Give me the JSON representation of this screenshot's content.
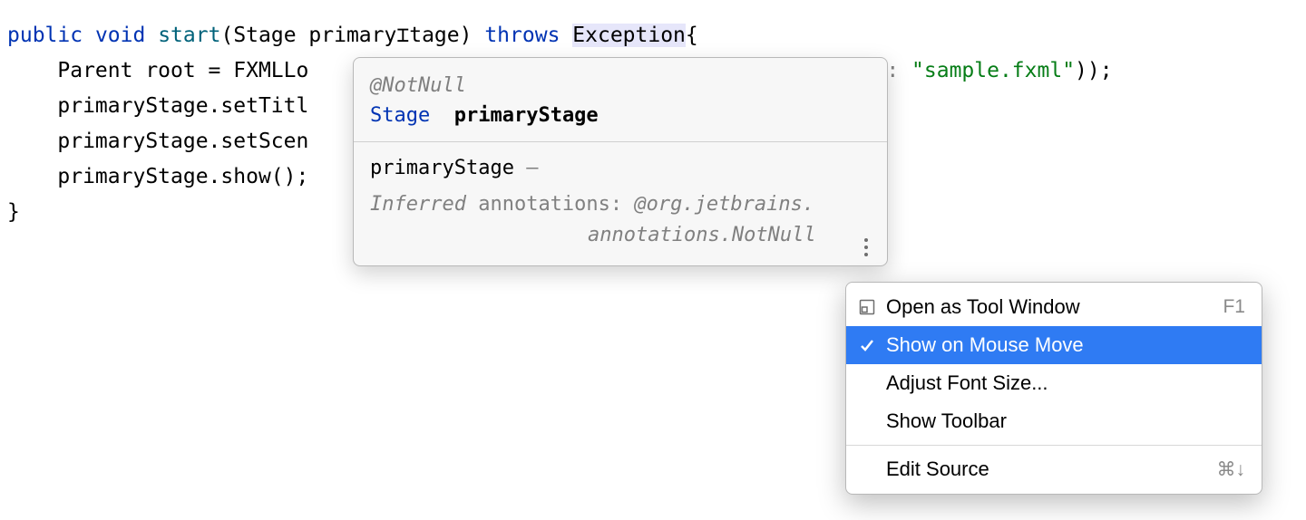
{
  "code": {
    "line1": {
      "public": "public",
      "void": "void",
      "start": "start",
      "open": "(",
      "Stage": "Stage",
      "sp": " ",
      "primary": "primary",
      "tage": "tage",
      "close": ")",
      "throws": "throws",
      "Exception": "Exception",
      "brace": "{"
    },
    "line2_pre": "    Parent root = FXMLLo",
    "line2_post_label": ": ",
    "line2_post_str": "\"sample.fxml\"",
    "line2_end": "));",
    "line3": "    primaryStage.setTitl",
    "line4": "    primaryStage.setScen",
    "line5": "    primaryStage.show();",
    "line6": "}"
  },
  "doc": {
    "annotation": "@NotNull",
    "type": "Stage",
    "param": "primaryStage",
    "name": "primaryStage",
    "dash": " – ",
    "inferred": "Inferred",
    "annotations_label": " annotations: ",
    "full_annotation_1": "@org.jetbrains.",
    "full_annotation_2": "annotations.NotNull"
  },
  "menu": {
    "items": [
      {
        "label": "Open as Tool Window",
        "shortcut": "F1",
        "icon": "window",
        "selected": false
      },
      {
        "label": "Show on Mouse Move",
        "shortcut": "",
        "icon": "check",
        "selected": true
      },
      {
        "label": "Adjust Font Size...",
        "shortcut": "",
        "icon": "",
        "selected": false
      },
      {
        "label": "Show Toolbar",
        "shortcut": "",
        "icon": "",
        "selected": false
      },
      {
        "label": "Edit Source",
        "shortcut": "⌘↓",
        "icon": "",
        "selected": false
      }
    ]
  }
}
